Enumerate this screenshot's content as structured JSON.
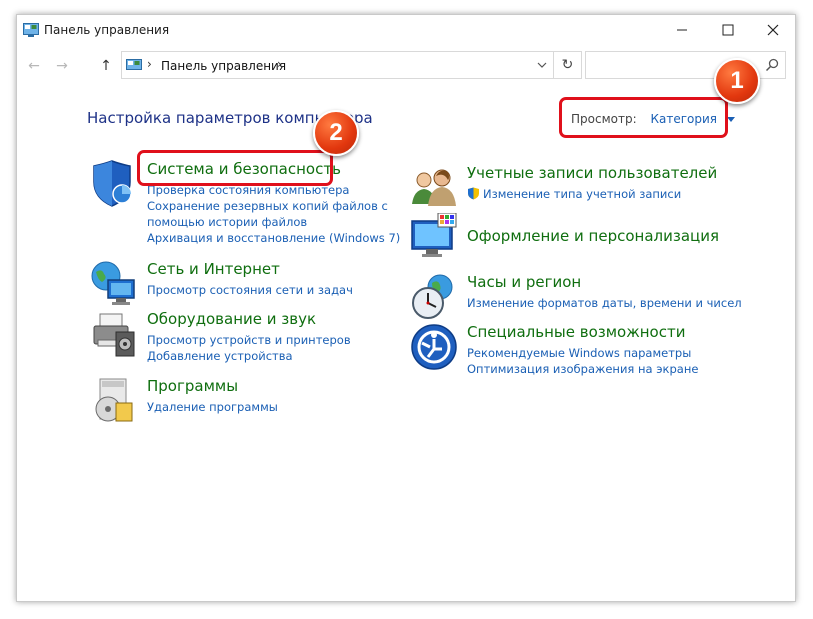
{
  "window": {
    "title": "Панель управления"
  },
  "address_bar": {
    "crumb": "Панель управления",
    "separator": "›"
  },
  "search": {
    "placeholder": ""
  },
  "content": {
    "heading": "Настройка параметров компьютера",
    "view_label": "Просмотр:",
    "view_value": "Категория"
  },
  "categories_left": [
    {
      "title": "Система и безопасность",
      "icon": "shield-security-icon",
      "links": [
        "Проверка состояния компьютера",
        "Сохранение резервных копий файлов с",
        "помощью истории файлов",
        "Архивация и восстановление (Windows 7)"
      ]
    },
    {
      "title": "Сеть и Интернет",
      "icon": "network-globe-icon",
      "links": [
        "Просмотр состояния сети и задач"
      ]
    },
    {
      "title": "Оборудование и звук",
      "icon": "printer-hardware-icon",
      "links": [
        "Просмотр устройств и принтеров",
        "Добавление устройства"
      ]
    },
    {
      "title": "Программы",
      "icon": "programs-disc-icon",
      "links": [
        "Удаление программы"
      ]
    }
  ],
  "categories_right": [
    {
      "title": "Учетные записи пользователей",
      "icon": "user-accounts-icon",
      "links": [
        "Изменение типа учетной записи"
      ]
    },
    {
      "title": "Оформление и персонализация",
      "icon": "personalization-monitor-icon",
      "links": []
    },
    {
      "title": "Часы и регион",
      "icon": "clock-globe-icon",
      "links": [
        "Изменение форматов даты, времени и чисел"
      ]
    },
    {
      "title": "Специальные возможности",
      "icon": "accessibility-icon",
      "links": [
        "Рекомендуемые Windows параметры",
        "Оптимизация изображения на экране"
      ]
    }
  ],
  "annotations": {
    "badge_1": "1",
    "badge_2": "2",
    "callout_color": "#e0101b",
    "badge_color": "#e2370e"
  }
}
